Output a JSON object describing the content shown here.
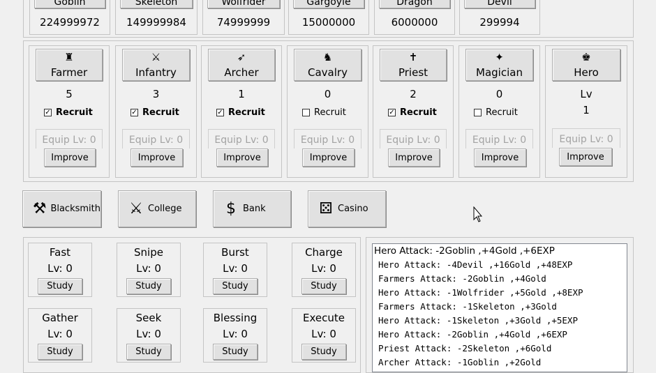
{
  "enemies": [
    {
      "name": "Goblin",
      "count": "224999972"
    },
    {
      "name": "Skeleton",
      "count": "149999984"
    },
    {
      "name": "Wolfrider",
      "count": "74999999"
    },
    {
      "name": "Gargoyle",
      "count": "15000000"
    },
    {
      "name": "Dragon",
      "count": "6000000"
    },
    {
      "name": "Devil",
      "count": "299994"
    }
  ],
  "units": [
    {
      "name": "Farmer",
      "icon": "farmer-icon",
      "glyph": "♜",
      "count": "5",
      "recruit": true
    },
    {
      "name": "Infantry",
      "icon": "infantry-icon",
      "glyph": "⚔",
      "count": "3",
      "recruit": true
    },
    {
      "name": "Archer",
      "icon": "archer-icon",
      "glyph": "➶",
      "count": "1",
      "recruit": true
    },
    {
      "name": "Cavalry",
      "icon": "cavalry-icon",
      "glyph": "♞",
      "count": "0",
      "recruit": false
    },
    {
      "name": "Priest",
      "icon": "priest-icon",
      "glyph": "✝",
      "count": "2",
      "recruit": true
    },
    {
      "name": "Magician",
      "icon": "magician-icon",
      "glyph": "✦",
      "count": "0",
      "recruit": false
    }
  ],
  "hero": {
    "name": "Hero",
    "icon": "hero-icon",
    "glyph": "♚",
    "lv_label": "Lv",
    "lv": "1"
  },
  "labels": {
    "recruit": "Recruit",
    "equip": "Equip Lv:  0",
    "improve": "Improve",
    "study": "Study"
  },
  "buildings": [
    {
      "name": "Blacksmith",
      "icon": "anvil-icon",
      "glyph": "⚒"
    },
    {
      "name": "College",
      "icon": "crossed-swords-icon",
      "glyph": "⚔"
    },
    {
      "name": "Bank",
      "icon": "money-bag-icon",
      "glyph": "$"
    },
    {
      "name": "Casino",
      "icon": "dice-icon",
      "glyph": "⚄"
    }
  ],
  "skills": [
    {
      "name": "Fast",
      "lv": "Lv:  0"
    },
    {
      "name": "Snipe",
      "lv": "Lv:  0"
    },
    {
      "name": "Burst",
      "lv": "Lv:  0"
    },
    {
      "name": "Charge",
      "lv": "Lv:  0"
    },
    {
      "name": "Gather",
      "lv": "Lv:  0"
    },
    {
      "name": "Seek",
      "lv": "Lv:  0"
    },
    {
      "name": "Blessing",
      "lv": "Lv:  0"
    },
    {
      "name": "Execute",
      "lv": "Lv:  0"
    }
  ],
  "log": [
    "Hero Attack: -2Goblin ,+4Gold ,+6EXP",
    "Hero Attack: -4Devil ,+16Gold ,+48EXP",
    "Farmers Attack: -2Goblin ,+4Gold",
    "Hero Attack: -1Wolfrider ,+5Gold ,+8EXP",
    "Farmers Attack: -1Skeleton ,+3Gold",
    "Hero Attack: -1Skeleton ,+3Gold ,+5EXP",
    "Hero Attack: -2Goblin ,+4Gold ,+6EXP",
    "Priest Attack: -2Skeleton ,+6Gold",
    "Archer Attack: -1Goblin ,+2Gold"
  ]
}
